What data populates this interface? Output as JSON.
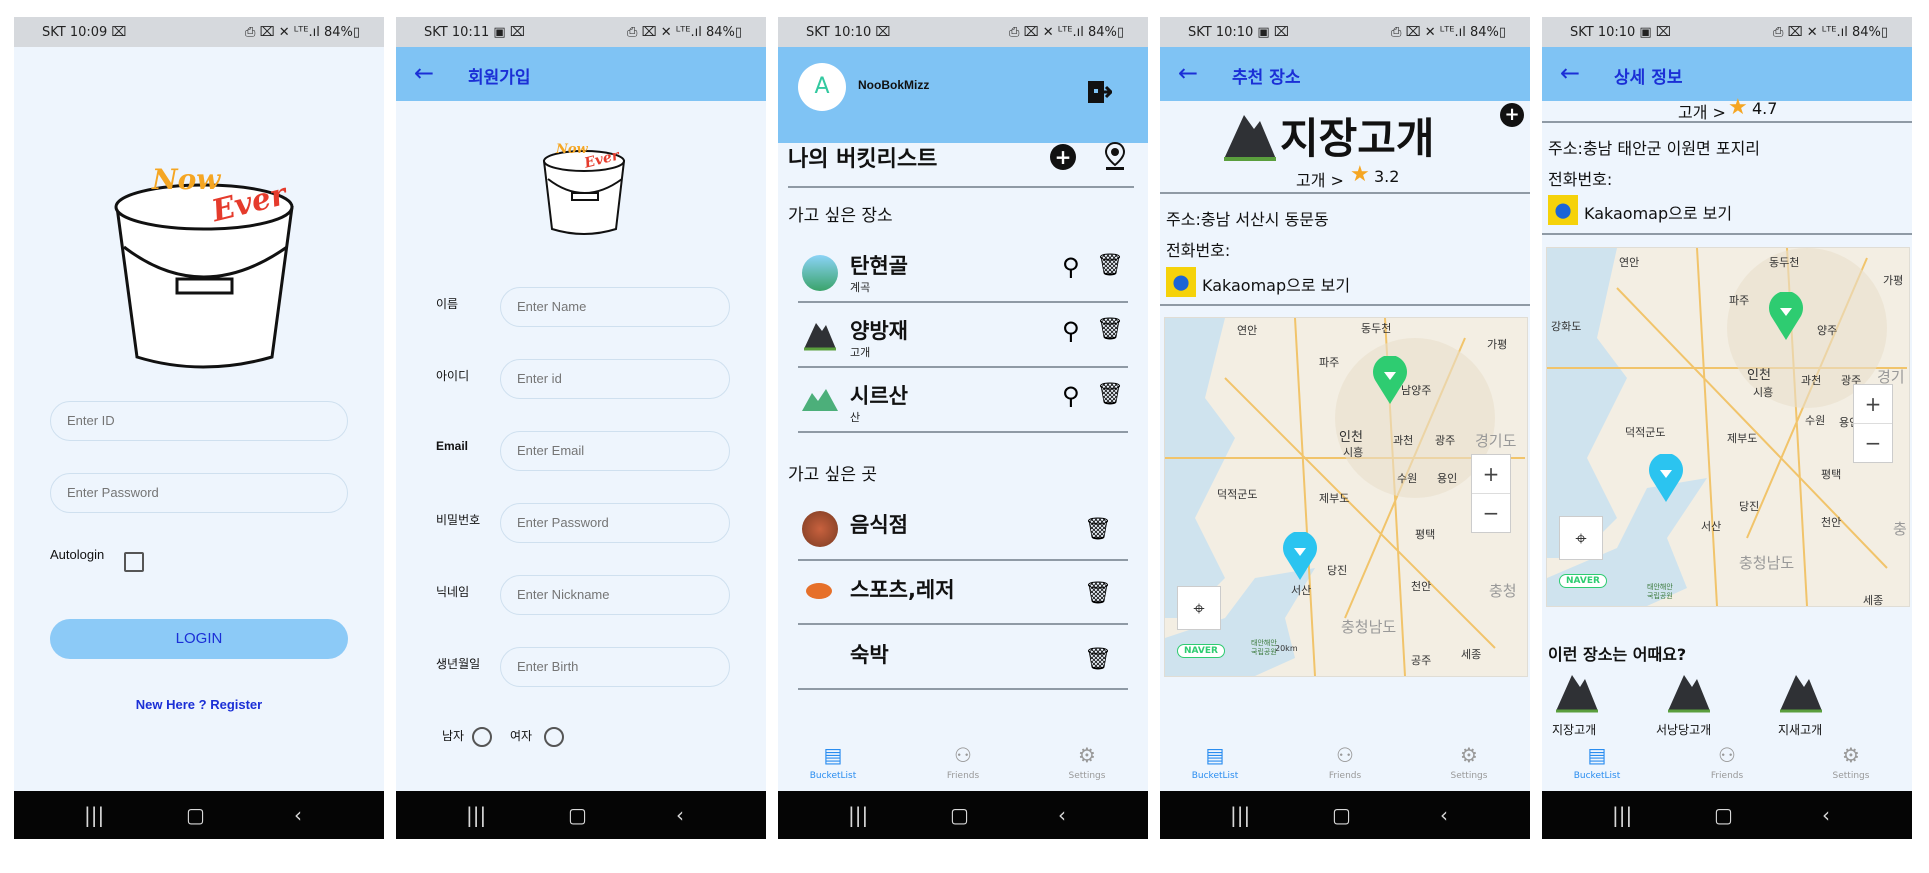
{
  "screens": {
    "login": {
      "status": {
        "left": "SKT 10:09 ⌧",
        "right": "⎙ ⌧ ✕ ᴸᵀᴱ.ıl 84%▯"
      },
      "logo_text": [
        "Now",
        "Ever"
      ],
      "id_placeholder": "Enter ID",
      "password_placeholder": "Enter Password",
      "autologin_label": "Autologin",
      "login_button": "LOGIN",
      "register_link": "New Here ? Register"
    },
    "register": {
      "status": {
        "left": "SKT 10:11 ▣ ⌧",
        "right": "⎙ ⌧ ✕ ᴸᵀᴱ.ıl 84%▯"
      },
      "title": "회원가입",
      "fields": [
        {
          "label": "이름",
          "placeholder": "Enter Name"
        },
        {
          "label": "아이디",
          "placeholder": "Enter id"
        },
        {
          "label": "Email",
          "placeholder": "Enter Email"
        },
        {
          "label": "비밀번호",
          "placeholder": "Enter Password"
        },
        {
          "label": "닉네임",
          "placeholder": "Enter Nickname"
        },
        {
          "label": "생년월일",
          "placeholder": "Enter Birth"
        }
      ],
      "gender_male": "남자",
      "gender_female": "여자"
    },
    "bucketlist": {
      "status": {
        "left": "SKT 10:10 ⌧",
        "right": "⎙ ⌧ ✕ ᴸᵀᴱ.ıl 84%▯"
      },
      "avatar_letter": "A",
      "username": "NooBokMizz",
      "heading": "나의 버킷리스트",
      "section_places": "가고 싶은 장소",
      "places": [
        {
          "name": "탄현골",
          "category": "계곡"
        },
        {
          "name": "양방재",
          "category": "고개"
        },
        {
          "name": "시르산",
          "category": "산"
        }
      ],
      "section_spots": "가고 싶은 곳",
      "spots": [
        {
          "name": "음식점"
        },
        {
          "name": "스포츠,레저"
        },
        {
          "name": "숙박"
        }
      ]
    },
    "recommend": {
      "status": {
        "left": "SKT 10:10 ▣ ⌧",
        "right": "⎙ ⌧ ✕ ᴸᵀᴱ.ıl 84%▯"
      },
      "title": "추천 장소",
      "place_name": "지장고개",
      "rating_prefix": "고개 >",
      "rating": "3.2",
      "address": "주소:충남 서산시 동문동",
      "phone": "전화번호:",
      "kakao_link": "Kakaomap으로 보기"
    },
    "detail": {
      "status": {
        "left": "SKT 10:10 ▣ ⌧",
        "right": "⎙ ⌧ ✕ ᴸᵀᴱ.ıl 84%▯"
      },
      "title": "상세 정보",
      "rating_prefix": "고개 >",
      "rating": "4.7",
      "address": "주소:충남 태안군 이원면 포지리",
      "phone": "전화번호:",
      "kakao_link": "Kakaomap으로 보기",
      "suggest_heading": "이런 장소는 어때요?",
      "suggestions": [
        "지장고개",
        "서낭당고개",
        "지새고개"
      ]
    }
  },
  "map_labels": {
    "rec": [
      "연안",
      "동두천",
      "가평",
      "파주",
      "남양주",
      "인천",
      "과천",
      "광주",
      "시흥",
      "수원",
      "용인",
      "경기도",
      "제부도",
      "덕적군도",
      "평택",
      "당진",
      "서산",
      "천안",
      "충청남도",
      "충청",
      "세종",
      "공주",
      "20km",
      "NAVER",
      "태안해안",
      "국립공원"
    ],
    "det": [
      "연안",
      "동두천",
      "가평",
      "강화도",
      "파주",
      "양주",
      "인천",
      "과천",
      "광주",
      "경기",
      "시흥",
      "수원",
      "용인",
      "제부도",
      "덕적군도",
      "평택",
      "당진",
      "서산",
      "천안",
      "충청남도",
      "충",
      "세종",
      "NAVER",
      "태안해안",
      "국립공원"
    ]
  },
  "tabs": [
    "BucketList",
    "Friends",
    "Settings"
  ],
  "colors": {
    "appbar": "#7fc3f4",
    "accent": "#1b2fd6",
    "background": "#eef5fd",
    "login_button": "#8ccaf7",
    "map_pin_green": "#2ecc71",
    "map_pin_cyan": "#2bc4f0",
    "star": "#f5a623"
  }
}
